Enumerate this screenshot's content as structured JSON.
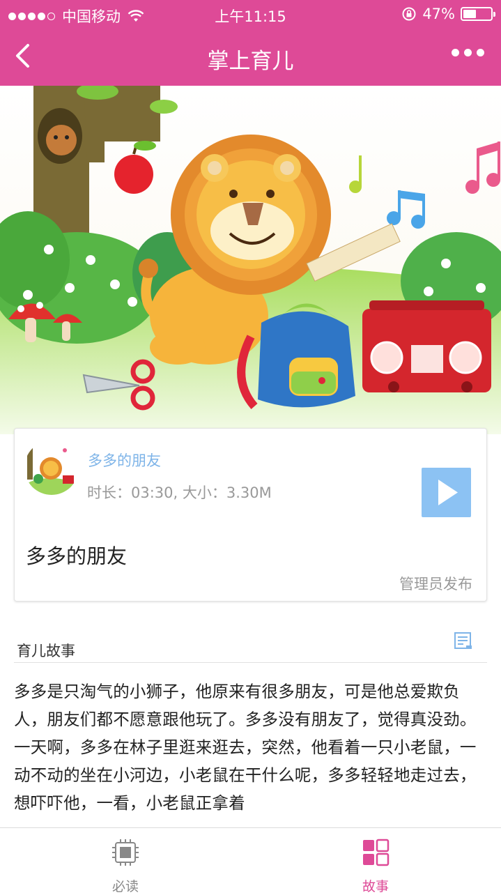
{
  "status_bar": {
    "carrier": "中国移动",
    "time": "上午11:15",
    "battery": "47%",
    "battery_level": 0.47,
    "icons": [
      "signal-dots-icon",
      "wifi-icon",
      "rotation-lock-icon",
      "battery-icon"
    ]
  },
  "nav": {
    "title": "掌上育儿",
    "back_icon": "chevron-left-icon",
    "more_icon": "more-dots-icon"
  },
  "colors": {
    "brand": "#de4a97",
    "link": "#7eb4e8",
    "play_button": "#8cc2f3",
    "muted_text": "#999999"
  },
  "hero": {
    "description_icon": "lion-illustration"
  },
  "audio_card": {
    "track_title": "多多的朋友",
    "meta": "时长：03:30, 大小：3.30M",
    "play_icon": "play-icon",
    "story_title": "多多的朋友",
    "publisher": "管理员发布"
  },
  "section": {
    "label": "育儿故事",
    "icon": "document-icon"
  },
  "story_text": "多多是只淘气的小狮子，他原来有很多朋友，可是他总爱欺负人，朋友们都不愿意跟他玩了。多多没有朋友了，觉得真没劲。一天啊，多多在林子里逛来逛去，突然，他看着一只小老鼠，一动不动的坐在小河边，小老鼠在干什么呢，多多轻轻地走过去，想吓吓他，一看，小老鼠正拿着",
  "tabbar": {
    "tabs": [
      {
        "label": "必读",
        "icon": "chip-icon",
        "active": false
      },
      {
        "label": "故事",
        "icon": "grid-icon",
        "active": true
      }
    ]
  }
}
